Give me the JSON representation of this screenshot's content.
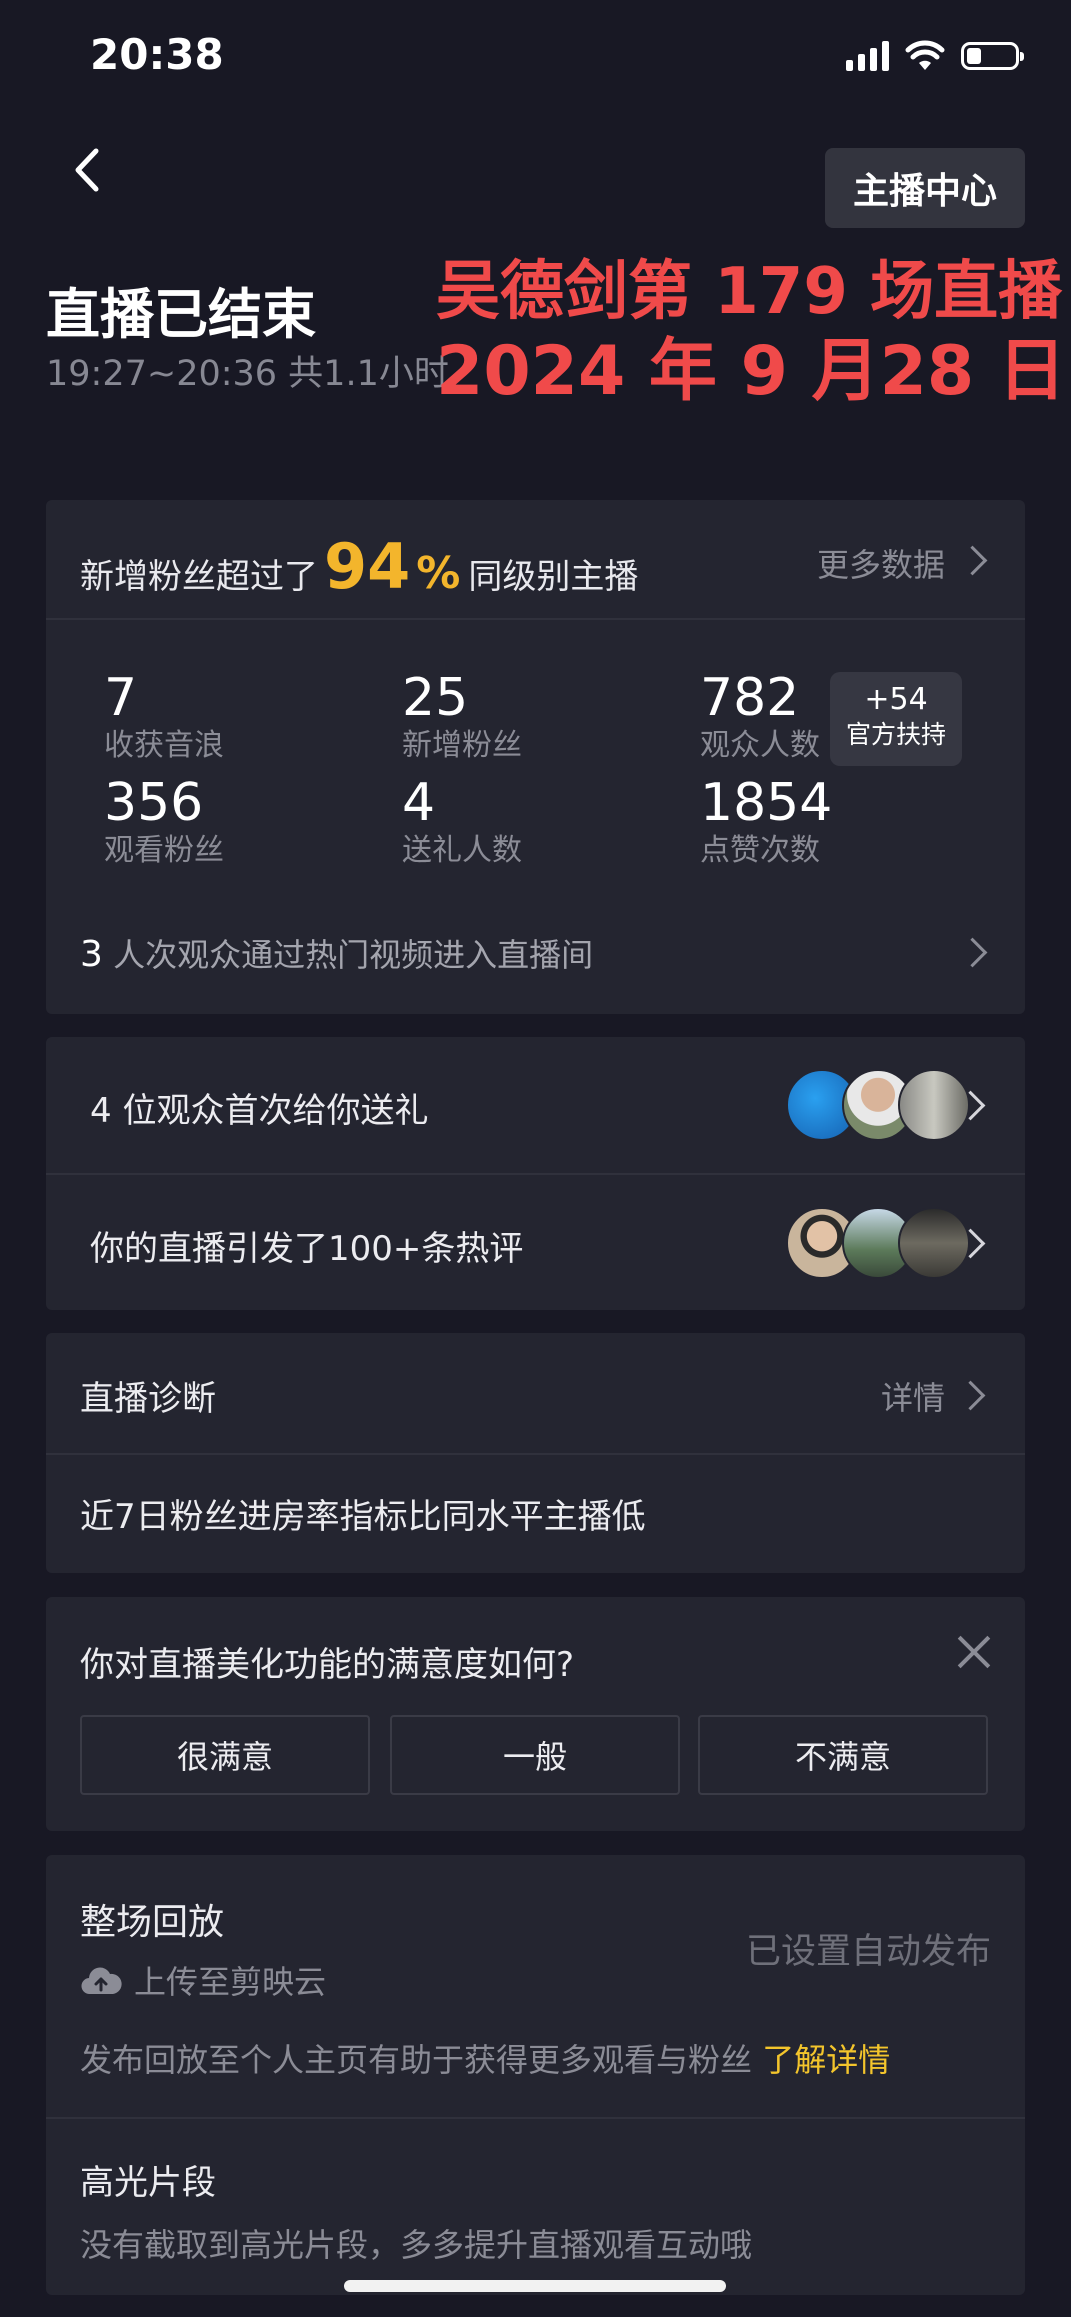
{
  "status_bar": {
    "time": "20:38"
  },
  "header": {
    "host_center_label": "主播中心",
    "title": "直播已结束",
    "time_range": "19:27~20:36 共1.1小时"
  },
  "overlay": {
    "line1": "吴德剑第 179 场直播",
    "line2": "2024 年 9 月28 日"
  },
  "summary_card": {
    "prefix": "新增粉丝超过了",
    "percent": "94",
    "percent_sign": "%",
    "suffix": "同级别主播",
    "more_label": "更多数据",
    "stats": [
      {
        "value": "7",
        "label": "收获音浪"
      },
      {
        "value": "25",
        "label": "新增粉丝"
      },
      {
        "value": "782",
        "label": "观众人数"
      },
      {
        "value": "356",
        "label": "观看粉丝"
      },
      {
        "value": "4",
        "label": "送礼人数"
      },
      {
        "value": "1854",
        "label": "点赞次数"
      }
    ],
    "official_support": {
      "value": "+54",
      "label": "官方扶持"
    },
    "hot_count": "3",
    "hot_text": " 人次观众通过热门视频进入直播间"
  },
  "gift_card": {
    "first_gift_text": "4 位观众首次给你送礼",
    "hot_comment_text": "你的直播引发了100+条热评"
  },
  "diagnosis_card": {
    "title": "直播诊断",
    "detail_label": "详情",
    "message": "近7日粉丝进房率指标比同水平主播低"
  },
  "survey_card": {
    "question": "你对直播美化功能的满意度如何?",
    "options": [
      "很满意",
      "一般",
      "不满意"
    ]
  },
  "replay_card": {
    "title": "整场回放",
    "upload_label": "上传至剪映云",
    "auto_publish_label": "已设置自动发布",
    "desc": "发布回放至个人主页有助于获得更多观看与粉丝 ",
    "learn_more": "了解详情",
    "highlight_title": "高光片段",
    "highlight_desc": "没有截取到高光片段，多多提升直播观看互动哦"
  },
  "colors": {
    "accent": "#f3b52c",
    "overlay_red": "#f04a4a",
    "card_bg": "#242530",
    "page_bg": "#181824"
  },
  "icons": [
    "signal-icon",
    "wifi-icon",
    "battery-icon",
    "back-chevron-icon",
    "chevron-right-icon",
    "close-icon",
    "cloud-upload-icon"
  ]
}
